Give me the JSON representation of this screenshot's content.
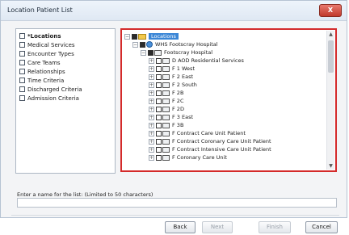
{
  "window": {
    "title": "Location Patient List",
    "close_label": "X"
  },
  "criteria": {
    "items": [
      {
        "label": "*Locations",
        "bold": true
      },
      {
        "label": "Medical Services"
      },
      {
        "label": "Encounter Types"
      },
      {
        "label": "Care Teams"
      },
      {
        "label": "Relationships"
      },
      {
        "label": "Time Criteria"
      },
      {
        "label": "Discharged Criteria"
      },
      {
        "label": "Admission Criteria"
      }
    ]
  },
  "tree": {
    "root": "Locations",
    "hospital": "WHS Footscray Hospital",
    "facility": "Footscray Hospital",
    "units": [
      "D AOD Residential Services",
      "F 1 West",
      "F 2 East",
      "F 2 South",
      "F 2B",
      "F 2C",
      "F 2D",
      "F 3 East",
      "F 3B",
      "F Contract Care Unit Patient",
      "F Contract Coronary Care Unit Patient",
      "F Contract Intensive Care Unit Patient",
      "F Coronary Care Unit"
    ]
  },
  "name_field": {
    "label": "Enter a name for the list: (Limited to 50 characters)",
    "value": ""
  },
  "buttons": {
    "back": "Back",
    "next": "Next",
    "finish": "Finish",
    "cancel": "Cancel"
  }
}
